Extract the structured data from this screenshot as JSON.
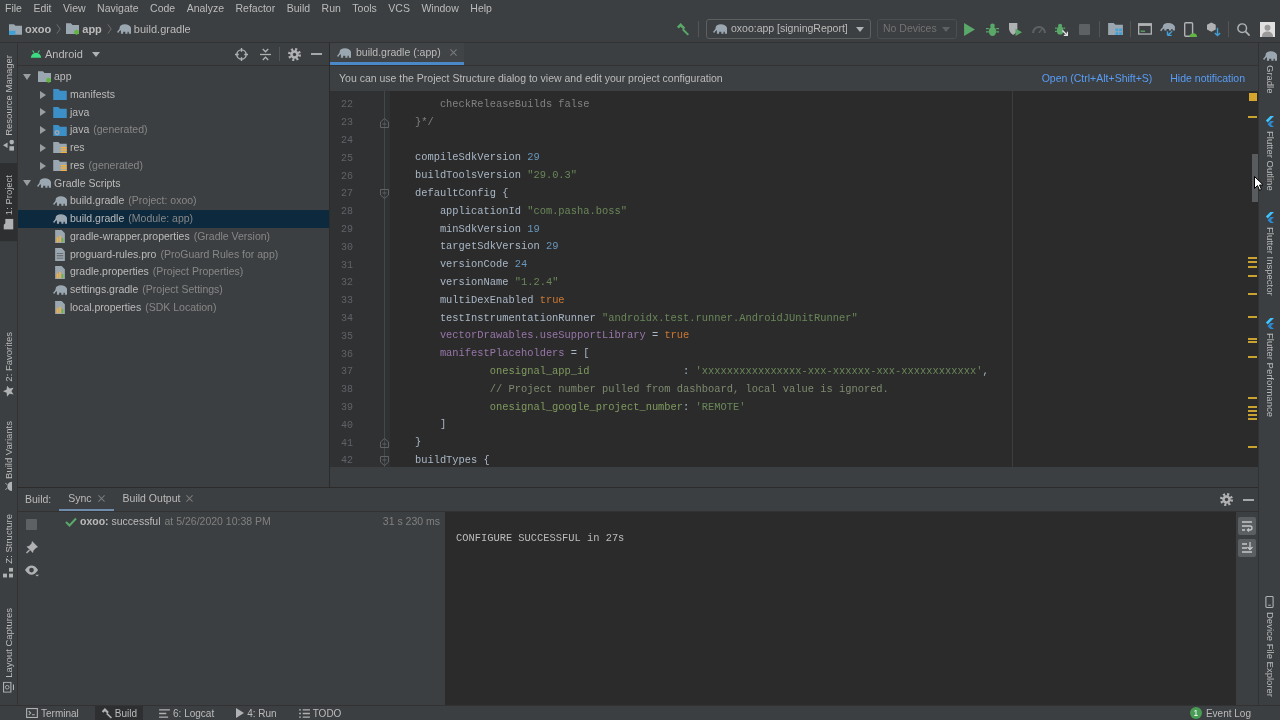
{
  "menu_bar": [
    "File",
    "Edit",
    "View",
    "Navigate",
    "Code",
    "Analyze",
    "Refactor",
    "Build",
    "Run",
    "Tools",
    "VCS",
    "Window",
    "Help"
  ],
  "breadcrumbs": [
    {
      "label": "oxoo",
      "kind": "folder"
    },
    {
      "label": "app",
      "kind": "module"
    },
    {
      "label": "build.gradle",
      "kind": "gradle"
    }
  ],
  "toolbar": {
    "run_configuration": "oxoo:app [signingReport]",
    "device_selector": {
      "label": "No Devices",
      "disabled": true
    },
    "actions": [
      {
        "kind": "run",
        "disabled": false
      },
      {
        "kind": "debug",
        "disabled": false
      },
      {
        "kind": "coverage",
        "disabled": false
      },
      {
        "kind": "profile",
        "disabled": true
      },
      {
        "kind": "apply_changes",
        "disabled": false
      },
      {
        "kind": "stop",
        "disabled": true
      }
    ]
  },
  "left_tool_strip": {
    "top": [
      {
        "label": "Resource Manager",
        "kind": "resources",
        "selected": false
      },
      {
        "label": "1: Project",
        "kind": "project",
        "selected": true
      }
    ],
    "middle": [
      {
        "label": "2: Favorites",
        "kind": "favorites",
        "selected": false
      },
      {
        "label": "Build Variants",
        "kind": "variants",
        "selected": false
      }
    ],
    "bottom": [
      {
        "label": "Z: Structure",
        "kind": "structure",
        "selected": false
      },
      {
        "label": "Layout Captures",
        "kind": "captures",
        "selected": false
      }
    ]
  },
  "project_panel": {
    "view": "Android",
    "tree": [
      {
        "label": "app",
        "kind": "module",
        "expanded": true,
        "selected": false,
        "children": [
          {
            "label": "manifests",
            "kind": "folder",
            "expanded": false,
            "selected": false
          },
          {
            "label": "java",
            "kind": "folder",
            "expanded": false,
            "selected": false
          },
          {
            "label": "java",
            "detail": "(generated)",
            "kind": "generated_folder",
            "expanded": false,
            "selected": false
          },
          {
            "label": "res",
            "kind": "resource_folder",
            "expanded": false,
            "selected": false
          },
          {
            "label": "res",
            "detail": "(generated)",
            "kind": "resource_folder",
            "expanded": false,
            "selected": false
          }
        ]
      },
      {
        "label": "Gradle Scripts",
        "kind": "gradle",
        "expanded": true,
        "selected": false,
        "children": [
          {
            "label": "build.gradle",
            "detail": "(Project: oxoo)",
            "kind": "gradle",
            "selected": false
          },
          {
            "label": "build.gradle",
            "detail": "(Module: app)",
            "kind": "gradle",
            "selected": true
          },
          {
            "label": "gradle-wrapper.properties",
            "detail": "(Gradle Version)",
            "kind": "properties",
            "selected": false
          },
          {
            "label": "proguard-rules.pro",
            "detail": "(ProGuard Rules for app)",
            "kind": "text",
            "selected": false
          },
          {
            "label": "gradle.properties",
            "detail": "(Project Properties)",
            "kind": "properties",
            "selected": false
          },
          {
            "label": "settings.gradle",
            "detail": "(Project Settings)",
            "kind": "gradle",
            "selected": false
          },
          {
            "label": "local.properties",
            "detail": "(SDK Location)",
            "kind": "properties",
            "selected": false
          }
        ]
      }
    ]
  },
  "editor": {
    "tabs": [
      {
        "label": "build.gradle (:app)",
        "selected": true
      }
    ],
    "notification": {
      "text": "You can use the Project Structure dialog to view and edit your project configuration",
      "links": [
        "Open (Ctrl+Alt+Shift+S)",
        "Hide notification"
      ]
    },
    "lines": [
      {
        "number": "22",
        "tokens": [
          {
            "text": "        checkReleaseBuilds false",
            "kind": "comment"
          }
        ]
      },
      {
        "number": "23",
        "fold_end": true,
        "tokens": [
          {
            "text": "    }*/",
            "kind": "comment"
          }
        ]
      },
      {
        "number": "24"
      },
      {
        "number": "25",
        "tokens": [
          {
            "text": "    compileSdkVersion ",
            "kind": "plain"
          },
          {
            "text": "29",
            "kind": "number"
          }
        ]
      },
      {
        "number": "26",
        "tokens": [
          {
            "text": "    buildToolsVersion ",
            "kind": "plain"
          },
          {
            "text": "\"29.0.3\"",
            "kind": "string"
          }
        ]
      },
      {
        "number": "27",
        "fold_start": true,
        "tokens": [
          {
            "text": "    defaultConfig {",
            "kind": "plain"
          }
        ]
      },
      {
        "number": "28",
        "tokens": [
          {
            "text": "        applicationId ",
            "kind": "plain"
          },
          {
            "text": "\"com.pasha.boss\"",
            "kind": "string"
          }
        ]
      },
      {
        "number": "29",
        "tokens": [
          {
            "text": "        minSdkVersion ",
            "kind": "plain"
          },
          {
            "text": "19",
            "kind": "number"
          }
        ]
      },
      {
        "number": "30",
        "tokens": [
          {
            "text": "        targetSdkVersion ",
            "kind": "plain"
          },
          {
            "text": "29",
            "kind": "number"
          }
        ]
      },
      {
        "number": "31",
        "tokens": [
          {
            "text": "        versionCode ",
            "kind": "plain"
          },
          {
            "text": "24",
            "kind": "number"
          }
        ]
      },
      {
        "number": "32",
        "tokens": [
          {
            "text": "        versionName ",
            "kind": "plain"
          },
          {
            "text": "\"1.2.4\"",
            "kind": "string"
          }
        ]
      },
      {
        "number": "33",
        "tokens": [
          {
            "text": "        multiDexEnabled ",
            "kind": "plain"
          },
          {
            "text": "true",
            "kind": "keyword"
          }
        ]
      },
      {
        "number": "34",
        "tokens": [
          {
            "text": "        testInstrumentationRunner ",
            "kind": "plain"
          },
          {
            "text": "\"androidx.test.runner.AndroidJUnitRunner\"",
            "kind": "string"
          }
        ]
      },
      {
        "number": "35",
        "tokens": [
          {
            "text": "        vectorDrawables.useSupportLibrary",
            "kind": "property"
          },
          {
            "text": " = ",
            "kind": "plain"
          },
          {
            "text": "true",
            "kind": "keyword"
          }
        ]
      },
      {
        "number": "36",
        "tokens": [
          {
            "text": "        manifestPlaceholders",
            "kind": "property"
          },
          {
            "text": " = [",
            "kind": "plain"
          }
        ]
      },
      {
        "number": "37",
        "tokens": [
          {
            "text": "                onesignal_app_id",
            "kind": "map_key"
          },
          {
            "text": "               : ",
            "kind": "plain"
          },
          {
            "text": "'xxxxxxxxxxxxxxxx-xxx-xxxxxx-xxx-xxxxxxxxxxxx'",
            "kind": "string"
          },
          {
            "text": ",",
            "kind": "plain"
          }
        ]
      },
      {
        "number": "38",
        "tokens": [
          {
            "text": "                // Project number pulled from dashboard, local value is ignored.",
            "kind": "line_comment"
          }
        ]
      },
      {
        "number": "39",
        "tokens": [
          {
            "text": "                onesignal_google_project_number",
            "kind": "map_key"
          },
          {
            "text": ": ",
            "kind": "plain"
          },
          {
            "text": "'REMOTE'",
            "kind": "string"
          }
        ]
      },
      {
        "number": "40",
        "tokens": [
          {
            "text": "        ]",
            "kind": "plain"
          }
        ]
      },
      {
        "number": "41",
        "fold_end": true,
        "tokens": [
          {
            "text": "    }",
            "kind": "plain"
          }
        ]
      },
      {
        "number": "42",
        "fold_start": true,
        "tokens": [
          {
            "text": "    buildTypes {",
            "kind": "plain"
          }
        ]
      }
    ]
  },
  "build_panel": {
    "title": "Build:",
    "tabs": [
      {
        "label": "Sync",
        "selected": true
      },
      {
        "label": "Build Output",
        "selected": false
      }
    ],
    "results": [
      {
        "title": "**oxoo:** successful",
        "time": "at 5/26/2020 10:38 PM",
        "duration": "31 s 230 ms",
        "success": true
      }
    ],
    "console": [
      "CONFIGURE SUCCESSFUL in 27s"
    ]
  },
  "right_tool_strip": {
    "top": [
      {
        "label": "Gradle",
        "kind": "gradle",
        "selected": false
      },
      {
        "label": "Flutter Outline",
        "kind": "flutter",
        "selected": false
      },
      {
        "label": "Flutter Inspector",
        "kind": "flutter",
        "selected": false
      },
      {
        "label": "Flutter Performance",
        "kind": "flutter",
        "selected": false
      }
    ],
    "bottom": [
      {
        "label": "Device File Explorer",
        "kind": "device",
        "selected": false
      }
    ]
  },
  "status_bar": {
    "tool_windows": [
      {
        "label": "Terminal",
        "kind": "terminal",
        "selected": false
      },
      {
        "label": "Build",
        "kind": "build",
        "selected": true
      },
      {
        "label": "6: Logcat",
        "kind": "logcat",
        "selected": false
      },
      {
        "label": "4: Run",
        "kind": "run",
        "selected": false
      },
      {
        "label": "TODO",
        "kind": "todo",
        "selected": false
      }
    ],
    "event_log": {
      "count": "1",
      "label": "Event Log"
    }
  }
}
